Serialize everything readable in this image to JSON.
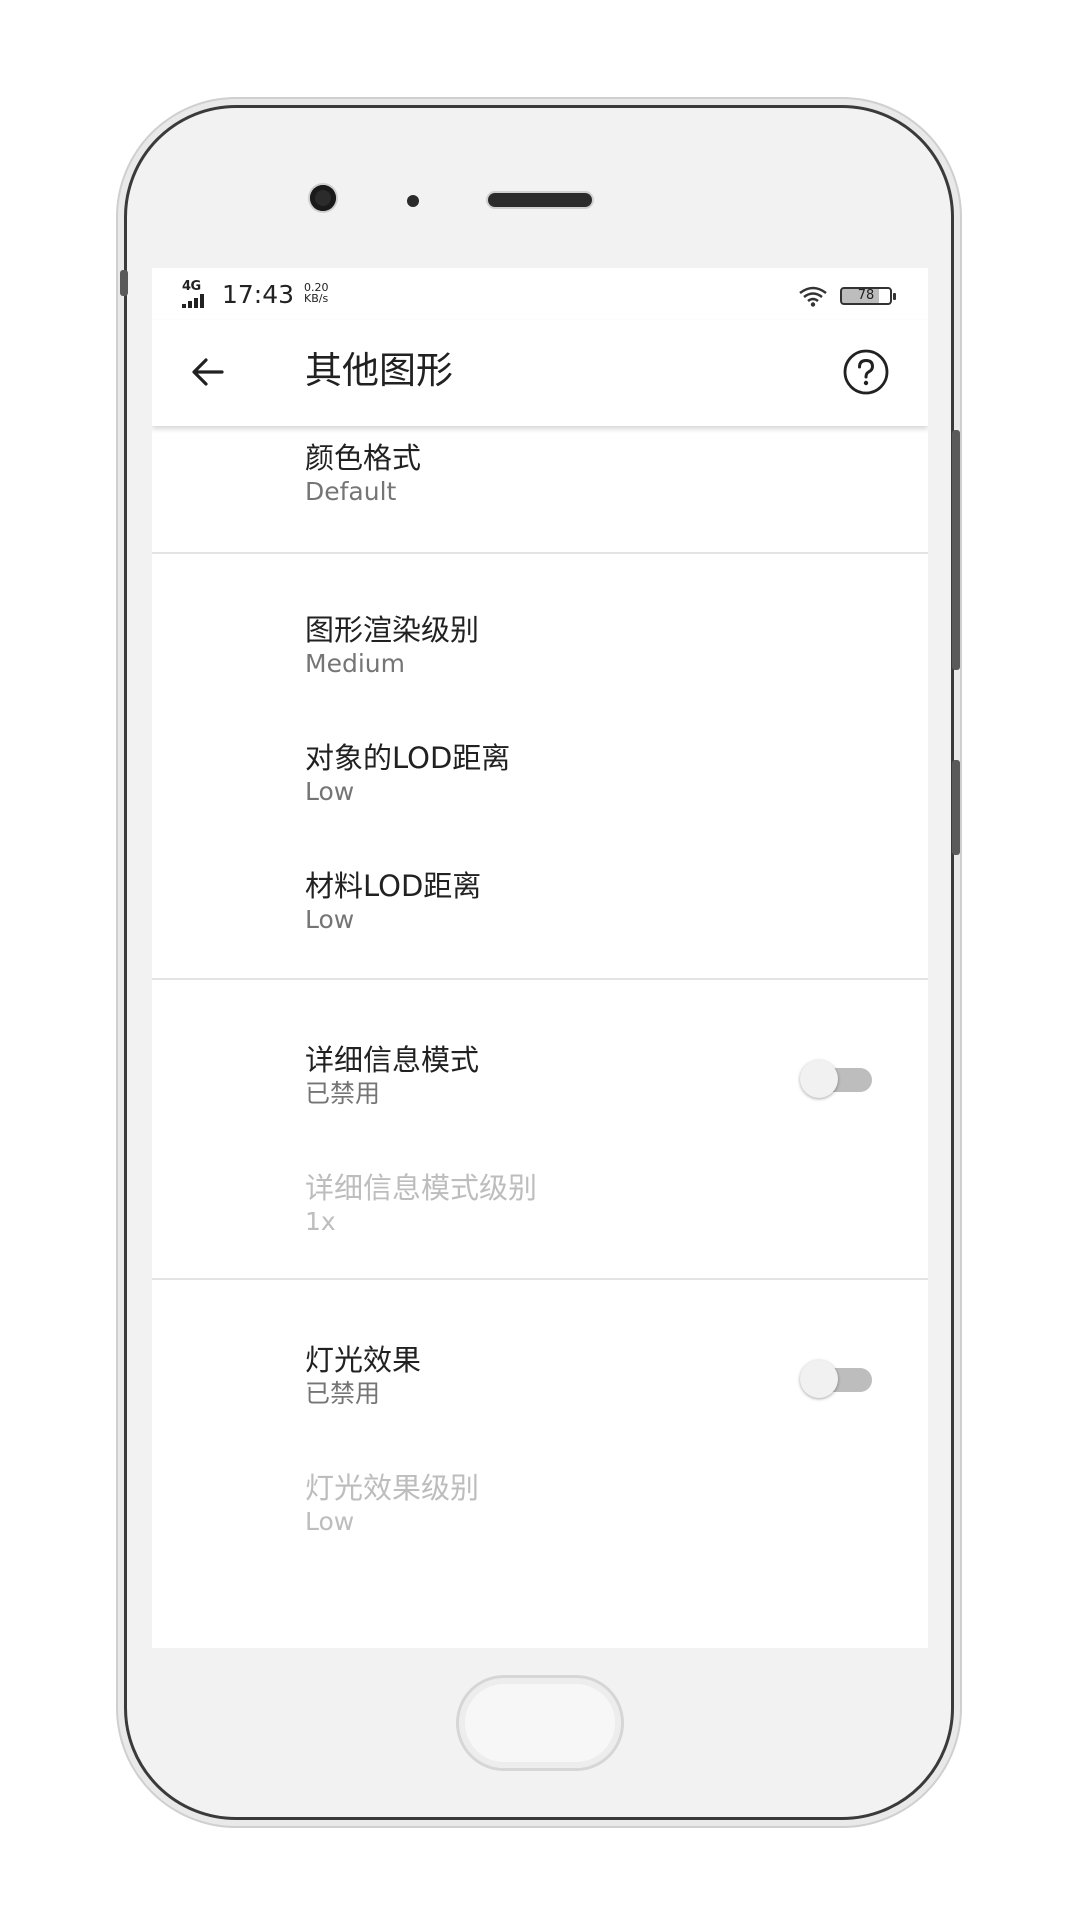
{
  "status_bar": {
    "network": "4G",
    "time": "17:43",
    "speed_value": "0.20",
    "speed_unit": "KB/s",
    "battery": "78",
    "battery_level_percent": 78
  },
  "app_bar": {
    "title": "其他图形",
    "back_icon": "arrow-left-icon",
    "help_icon": "question-circle-icon"
  },
  "settings": {
    "color_format": {
      "title": "颜色格式",
      "value": "Default"
    },
    "render_level": {
      "title": "图形渲染级别",
      "value": "Medium"
    },
    "object_lod": {
      "title": "对象的LOD距离",
      "value": "Low"
    },
    "material_lod": {
      "title": "材料LOD距离",
      "value": "Low"
    },
    "detail_mode": {
      "title": "详细信息模式",
      "value": "已禁用",
      "enabled": false
    },
    "detail_mode_level": {
      "title": "详细信息模式级别",
      "value": "1x"
    },
    "lighting": {
      "title": "灯光效果",
      "value": "已禁用",
      "enabled": false
    },
    "lighting_level": {
      "title": "灯光效果级别",
      "value": "Low"
    }
  },
  "colors": {
    "primary_text": "#212121",
    "secondary_text": "#757575",
    "disabled_text": "#bdbdbd",
    "divider": "#e3e3e3",
    "toggle_track_off": "#bdbdbd",
    "toggle_thumb_off": "#f1f1f1"
  }
}
